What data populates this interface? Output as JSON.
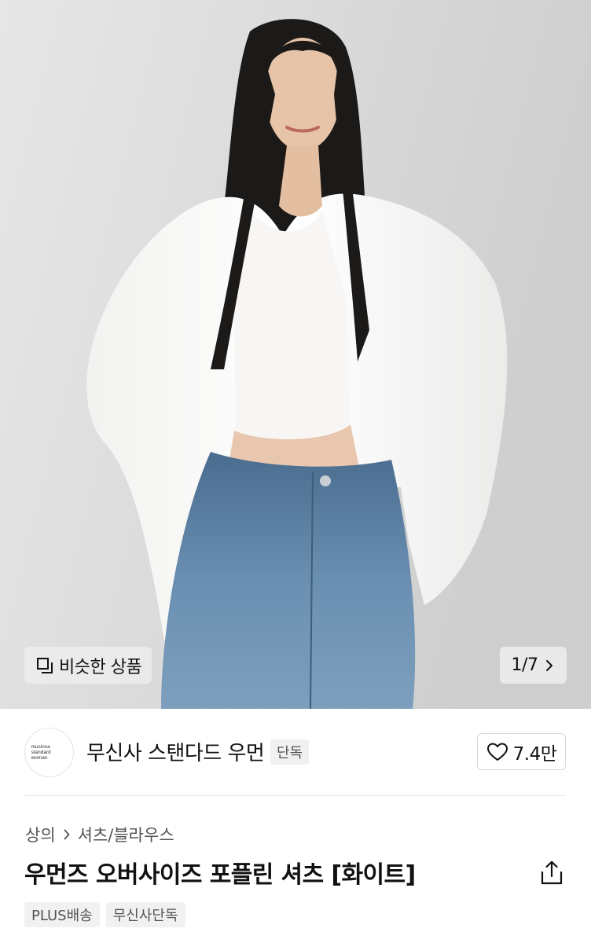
{
  "gallery": {
    "similar_label": "비슷한 상품",
    "current_page": "1",
    "total_pages": "7",
    "page_indicator": "1/7"
  },
  "brand": {
    "logo_text": "musinsa standard woman",
    "name": "무신사 스탠다드 우먼",
    "badge": "단독"
  },
  "like": {
    "count": "7.4만"
  },
  "breadcrumb": {
    "items": [
      "상의",
      "셔츠/블라우스"
    ]
  },
  "product": {
    "title": "우먼즈 오버사이즈 포플린 셔츠 [화이트]"
  },
  "tags": [
    "PLUS배송",
    "무신사단독"
  ],
  "icons": {
    "similar": "overlapping-squares-icon",
    "pager": "chevron-right-icon",
    "like": "heart-outline-icon",
    "breadcrumb_separator": "chevron-right-icon",
    "share": "share-upload-icon"
  }
}
